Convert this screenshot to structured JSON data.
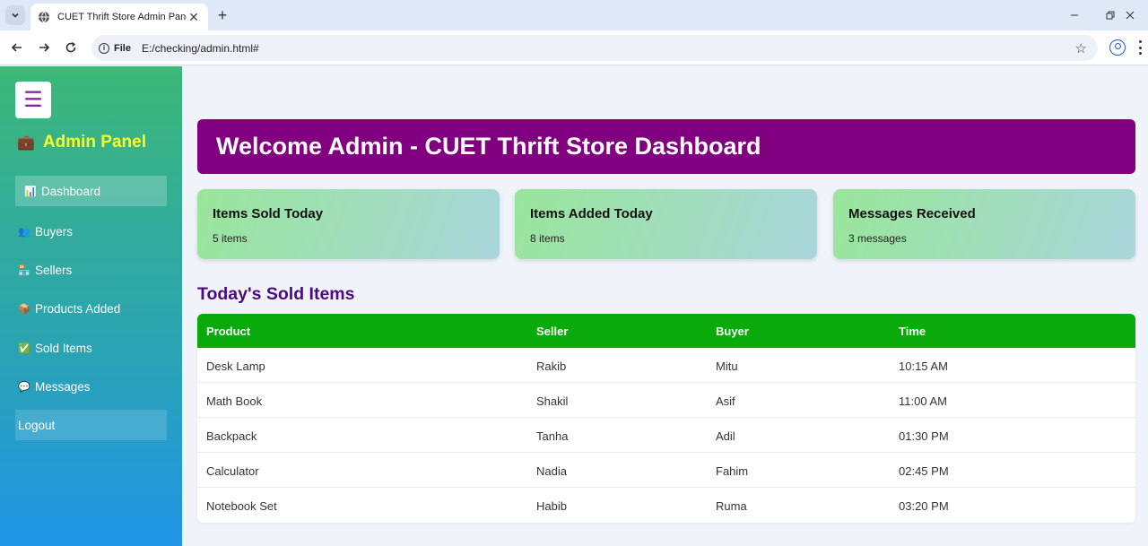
{
  "browser": {
    "tab_title": "CUET Thrift Store Admin Panel",
    "new_tab": "+",
    "url_scheme": "File",
    "url": "E:/checking/admin.html#"
  },
  "sidebar": {
    "hamburger": "☰",
    "brand_icon": "💼",
    "brand": "Admin Panel",
    "items": [
      {
        "icon": "📊",
        "label": "Dashboard"
      },
      {
        "icon": "👥",
        "label": "Buyers"
      },
      {
        "icon": "🏪",
        "label": "Sellers"
      },
      {
        "icon": "📦",
        "label": "Products Added"
      },
      {
        "icon": "✅",
        "label": "Sold Items"
      },
      {
        "icon": "💬",
        "label": "Messages"
      },
      {
        "icon": "",
        "label": "Logout"
      }
    ]
  },
  "main": {
    "welcome": "Welcome Admin - CUET Thrift Store Dashboard",
    "cards": [
      {
        "title": "Items Sold Today",
        "value": "5 items"
      },
      {
        "title": "Items Added Today",
        "value": "8 items"
      },
      {
        "title": "Messages Received",
        "value": "3 messages"
      }
    ],
    "section_title": "Today's Sold Items",
    "table": {
      "headers": [
        "Product",
        "Seller",
        "Buyer",
        "Time"
      ],
      "rows": [
        [
          "Desk Lamp",
          "Rakib",
          "Mitu",
          "10:15 AM"
        ],
        [
          "Math Book",
          "Shakil",
          "Asif",
          "11:00 AM"
        ],
        [
          "Backpack",
          "Tanha",
          "Adil",
          "01:30 PM"
        ],
        [
          "Calculator",
          "Nadia",
          "Fahim",
          "02:45 PM"
        ],
        [
          "Notebook Set",
          "Habib",
          "Ruma",
          "03:20 PM"
        ]
      ]
    }
  },
  "colors": {
    "banner": "#800080",
    "table_header": "#0aaa0a",
    "brand_text": "#ffff24",
    "section_title": "#4b0a82"
  }
}
